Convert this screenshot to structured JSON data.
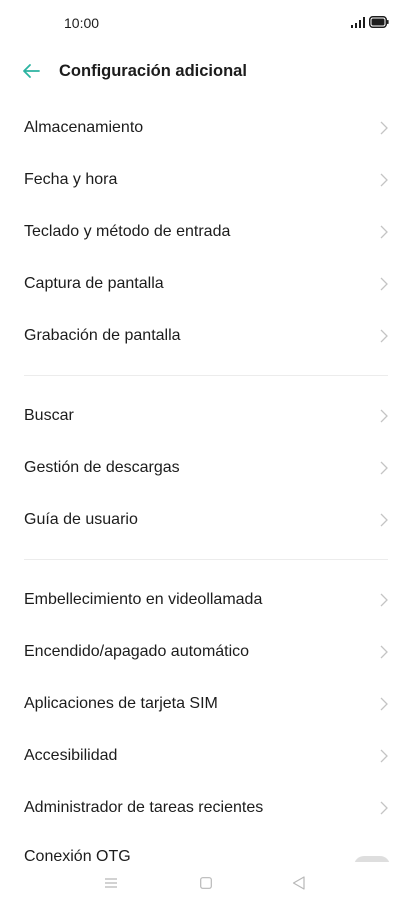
{
  "status_bar": {
    "time": "10:00",
    "signal_icon": "signal-icon",
    "battery_icon": "battery-icon"
  },
  "header": {
    "back_icon": "arrow-left-icon",
    "title": "Configuración adicional",
    "accent_color": "#2bb3a0"
  },
  "groups": [
    {
      "items": [
        {
          "label": "Almacenamiento"
        },
        {
          "label": "Fecha y hora"
        },
        {
          "label": "Teclado y método de entrada"
        },
        {
          "label": "Captura de pantalla"
        },
        {
          "label": "Grabación de pantalla"
        }
      ]
    },
    {
      "items": [
        {
          "label": "Buscar"
        },
        {
          "label": "Gestión de descargas"
        },
        {
          "label": "Guía de usuario"
        }
      ]
    },
    {
      "items": [
        {
          "label": "Embellecimiento en videollamada"
        },
        {
          "label": "Encendido/apagado automático"
        },
        {
          "label": "Aplicaciones de tarjeta SIM"
        },
        {
          "label": "Accesibilidad"
        },
        {
          "label": "Administrador de tareas recientes"
        }
      ]
    }
  ],
  "partial_item": {
    "label": "Conexión OTG"
  },
  "nav_bar": {
    "menu_icon": "menu-icon",
    "home_icon": "home-square-icon",
    "back_icon": "back-triangle-icon"
  }
}
